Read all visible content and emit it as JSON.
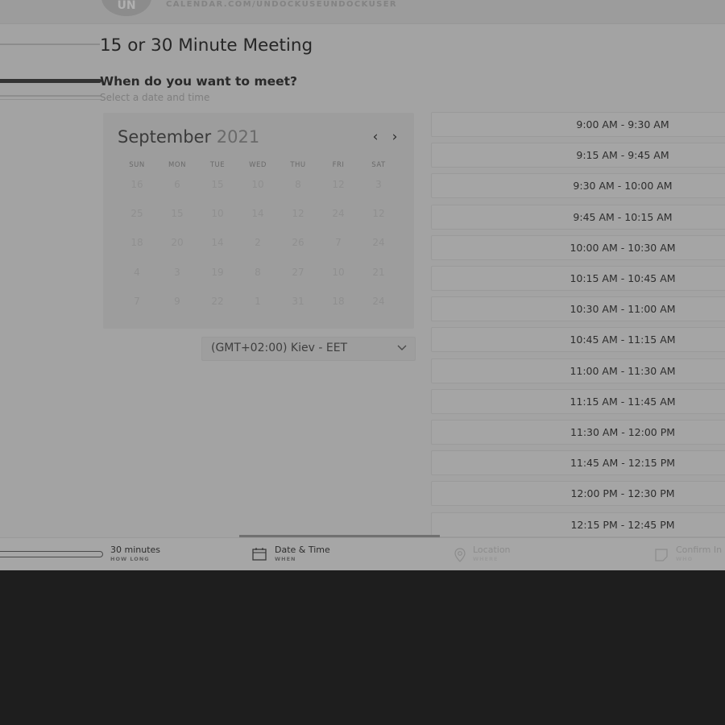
{
  "header": {
    "avatar_initials": "UN",
    "profile_url": "CALENDAR.COM/UNDOCKUSEUNDOCKUSER"
  },
  "meeting": {
    "title": "15 or 30 Minute Meeting",
    "question": "When do you want to meet?",
    "subtitle": "Select a date and time"
  },
  "calendar": {
    "month": "September",
    "year": "2021",
    "prev_icon": "chevron-left-icon",
    "next_icon": "chevron-right-icon",
    "weekdays": [
      "SUN",
      "MON",
      "TUE",
      "WED",
      "THU",
      "FRI",
      "SAT"
    ],
    "weeks": [
      [
        "16",
        "6",
        "15",
        "10",
        "8",
        "12",
        "3"
      ],
      [
        "25",
        "15",
        "10",
        "14",
        "12",
        "24",
        "12"
      ],
      [
        "18",
        "20",
        "14",
        "2",
        "26",
        "7",
        "24"
      ],
      [
        "4",
        "3",
        "19",
        "8",
        "27",
        "10",
        "21"
      ],
      [
        "7",
        "9",
        "22",
        "1",
        "31",
        "18",
        "24"
      ]
    ]
  },
  "timezone": {
    "selected": "(GMT+02:00) Kiev - EET",
    "icon": "chevron-down-icon"
  },
  "time_slots": [
    "9:00 AM - 9:30 AM",
    "9:15 AM - 9:45 AM",
    "9:30 AM - 10:00 AM",
    "9:45 AM - 10:15 AM",
    "10:00 AM - 10:30 AM",
    "10:15 AM - 10:45 AM",
    "10:30 AM - 11:00 AM",
    "10:45 AM - 11:15 AM",
    "11:00 AM - 11:30 AM",
    "11:15 AM - 11:45 AM",
    "11:30 AM - 12:00 PM",
    "11:45 AM - 12:15 PM",
    "12:00 PM - 12:30 PM",
    "12:15 PM - 12:45 PM"
  ],
  "steps": [
    {
      "title": "30 minutes",
      "sub": "HOW LONG",
      "icon": ""
    },
    {
      "title": "Date & Time",
      "sub": "WHEN",
      "icon": "calendar-icon"
    },
    {
      "title": "Location",
      "sub": "WHERE",
      "icon": "location-pin-icon"
    },
    {
      "title": "Confirm In",
      "sub": "WHO",
      "icon": "note-icon"
    }
  ],
  "colors": {
    "overlay_bg": "#a3a3a3",
    "page_bg": "#1e1e1e"
  }
}
